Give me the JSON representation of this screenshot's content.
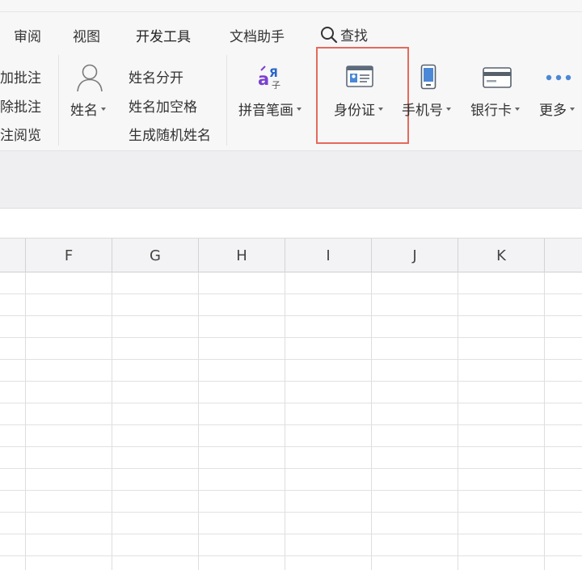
{
  "tabs": [
    {
      "label": "审阅"
    },
    {
      "label": "视图"
    },
    {
      "label": "开发工具"
    },
    {
      "label": "文档助手"
    }
  ],
  "search": {
    "label": "查找",
    "icon": "search-icon"
  },
  "comments_group": {
    "add": "添加批注",
    "delete": "删除批注",
    "review": "批注阅览"
  },
  "name_group": {
    "name_button": "姓名",
    "split": "姓名分开",
    "add_space": "姓名加空格",
    "random": "生成随机姓名"
  },
  "tools": {
    "pinyin": "拼音笔画",
    "id_card": "身份证",
    "phone": "手机号",
    "bank_card": "银行卡",
    "more": "更多"
  },
  "columns": [
    "F",
    "G",
    "H",
    "I",
    "J",
    "K"
  ],
  "colors": {
    "highlight": "#e46a5c",
    "pinyin_accent": "#7b3fd0"
  }
}
